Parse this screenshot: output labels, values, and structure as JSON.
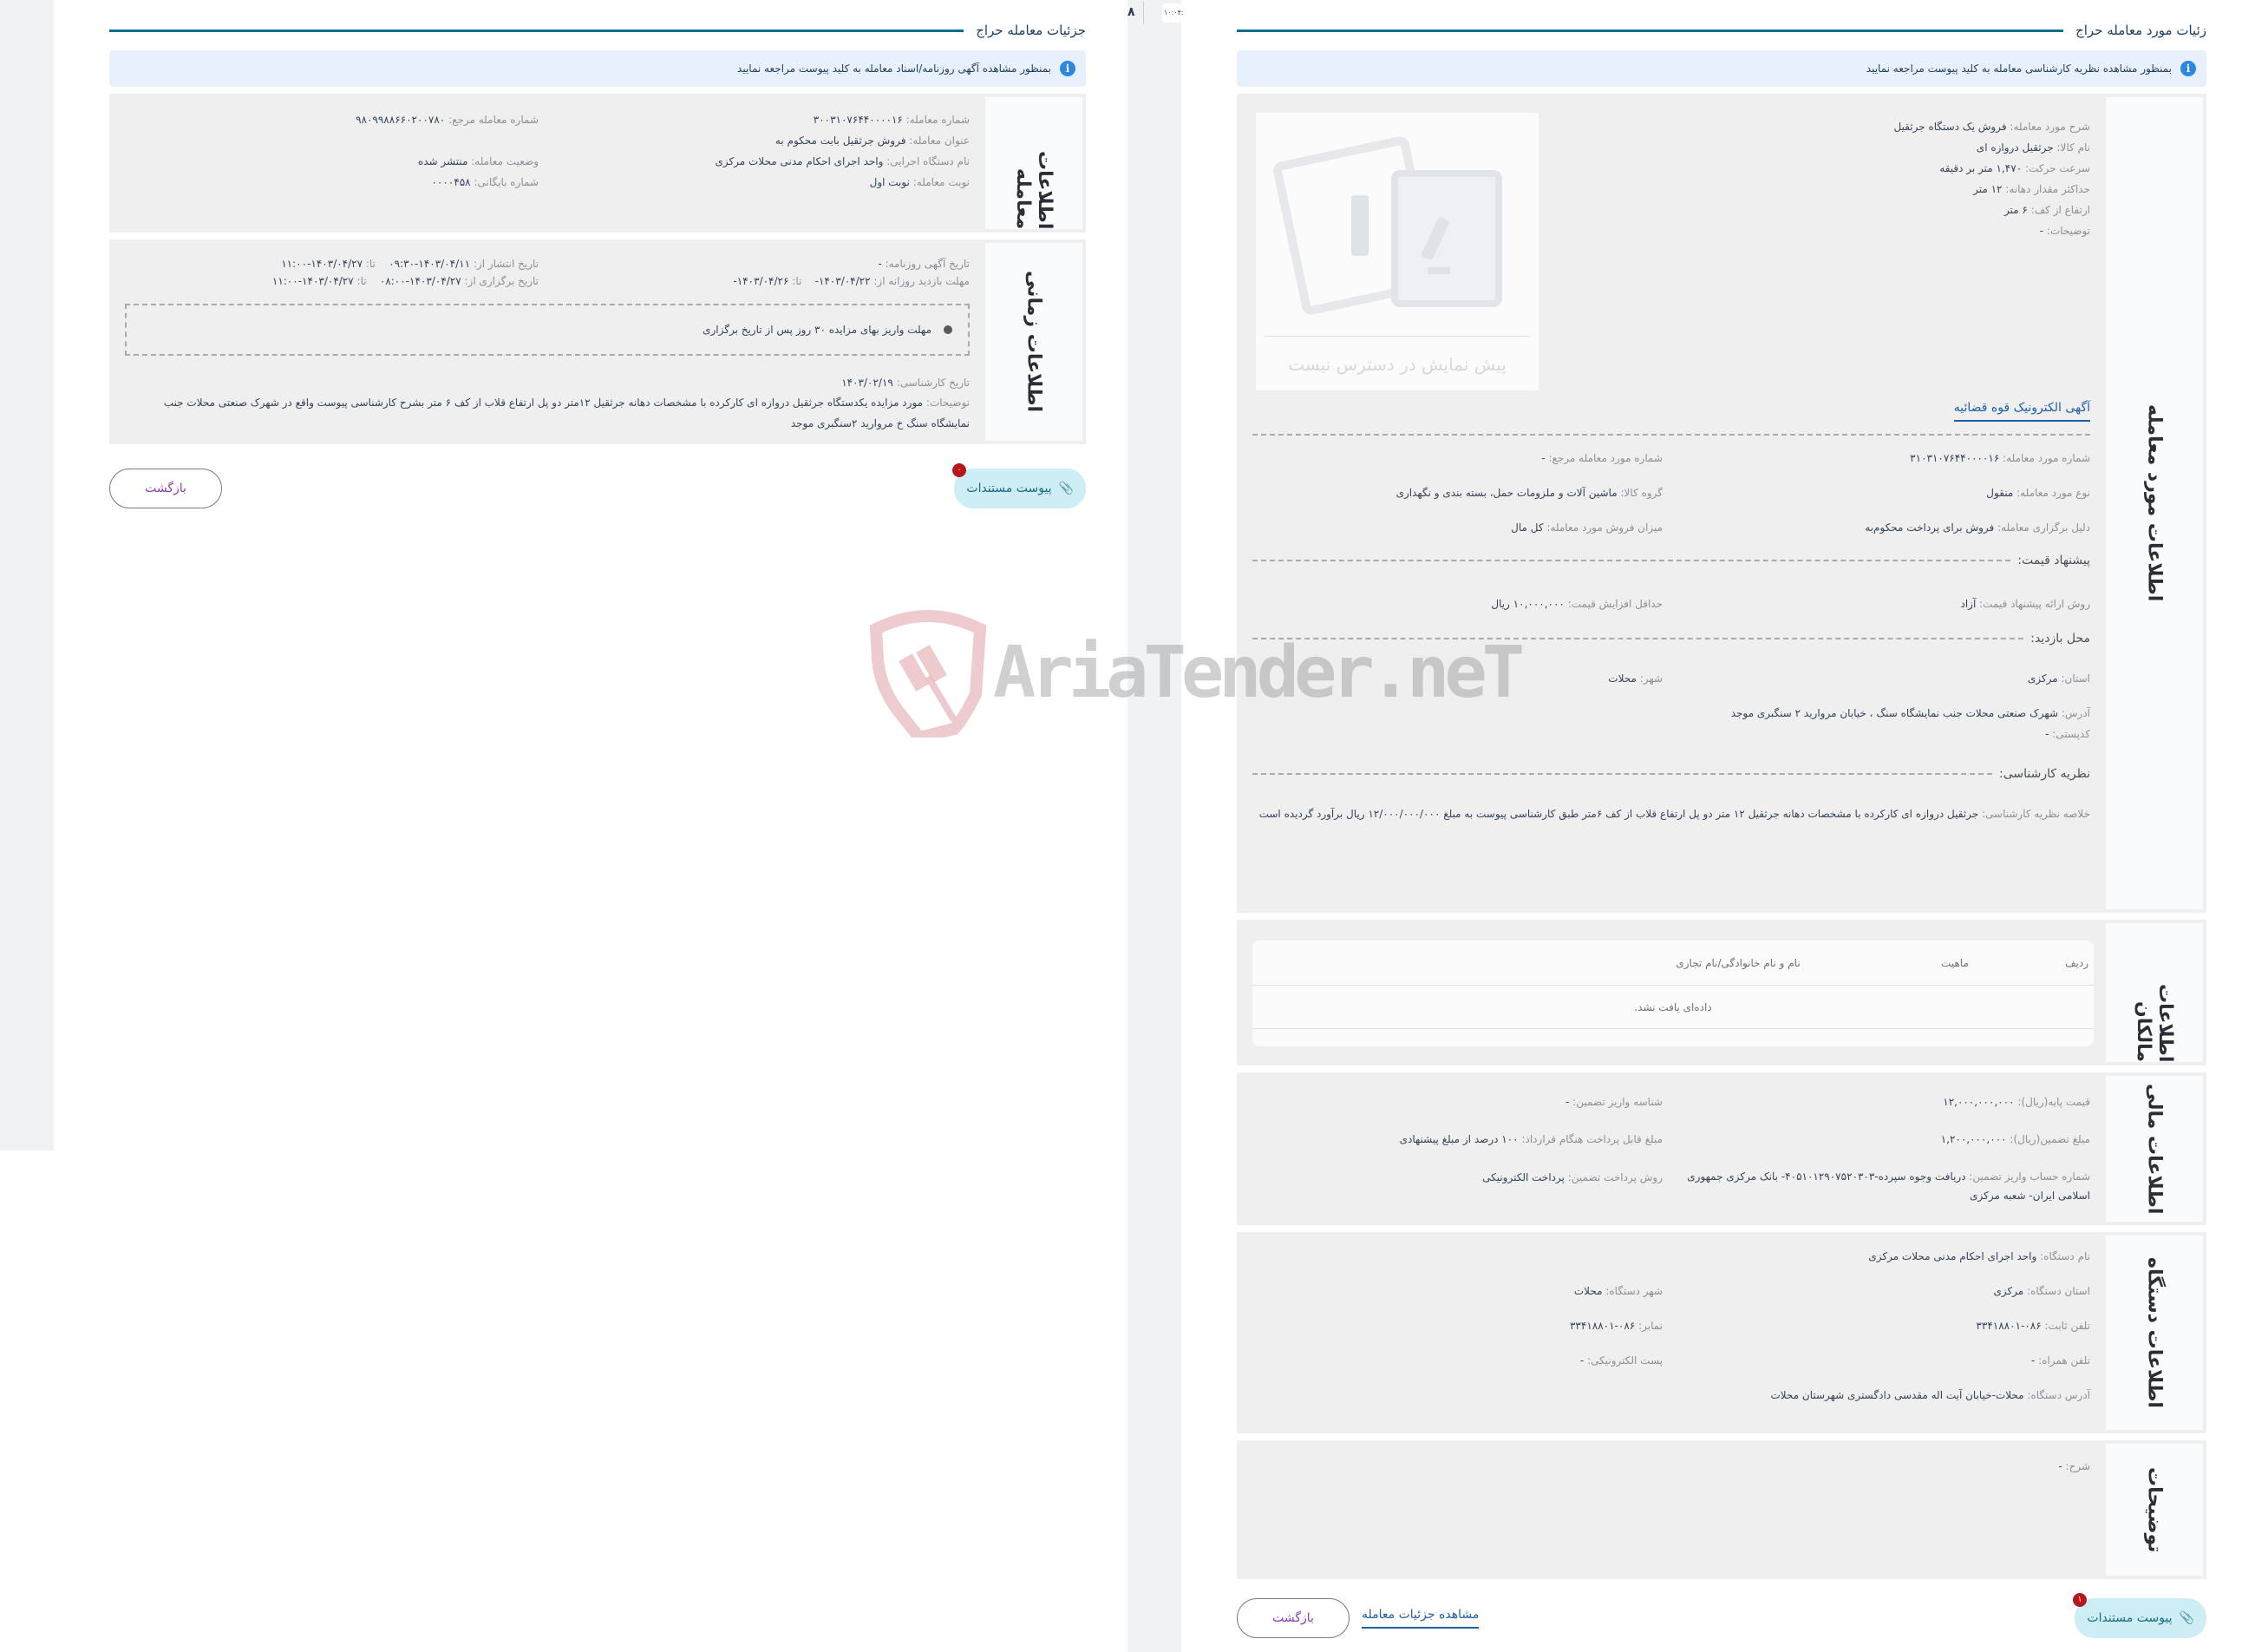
{
  "topbar": {
    "time_fragment": "۱۰:۰۴:",
    "glyph": "۸"
  },
  "left_panel": {
    "title": "جزئیات معامله حراج",
    "info_text": "بمنظور مشاهده آگهی روزنامه/اسناد معامله به کلید پیوست مراجعه نمایید",
    "deal_info": {
      "label": "اطلاعات معامله",
      "fields": {
        "deal_number": {
          "label": "شماره معامله:",
          "value": "۳۰۰۳۱۰۷۶۴۴۰۰۰۰۱۶"
        },
        "ref_number": {
          "label": "شماره معامله مرجع:",
          "value": "۹۸۰۹۹۸۸۶۶۰۲۰۰۷۸۰"
        },
        "deal_title": {
          "label": "عنوان معامله:",
          "value": "فروش جرثقیل بابت محکوم به"
        },
        "executor": {
          "label": "نام دستگاه اجرایی:",
          "value": "واحد اجرای احکام مدنی محلات مرکزی"
        },
        "status": {
          "label": "وضعیت معامله:",
          "value": "منتشر شده"
        },
        "round": {
          "label": "نوبت معامله:",
          "value": "نوبت اول"
        },
        "archive": {
          "label": "شماره بایگانی:",
          "value": "۰۰۰۰۴۵۸"
        }
      }
    },
    "time_info": {
      "label": "اطلاعات زمانی",
      "newspaper_date": {
        "label": "تاریخ آگهی روزنامه:",
        "value": "-"
      },
      "visit": {
        "label": "مهلت بازدید روزانه از:",
        "from": "۱۴۰۳/۰۴/۲۲-",
        "to_label": "تا:",
        "to": "۱۴۰۳/۰۴/۲۶-"
      },
      "publish": {
        "label": "تاریخ انتشار از:",
        "from": "۱۴۰۳/۰۴/۱۱-۰۹:۳۰",
        "to_label": "تا:",
        "to": "۱۴۰۳/۰۴/۲۷-۱۱:۰۰"
      },
      "hold": {
        "label": "تاریخ برگزاری از:",
        "from": "۱۴۰۳/۰۴/۲۷-۰۸:۰۰",
        "to_label": "تا:",
        "to": "۱۴۰۳/۰۴/۲۷-۱۱:۰۰"
      },
      "notice": "مهلت واریز بهای مزایده ۳۰ روز پس از تاریخ برگزاری",
      "expert_date": {
        "label": "تاریخ کارشناسی:",
        "value": "۱۴۰۳/۰۲/۱۹"
      },
      "description": {
        "label": "توضیحات:",
        "value": "مورد مزایده یکدستگاه جرثقیل دروازه ای کارکرده با مشخصات دهانه جرثقیل ۱۲متر دو پل ارتفاع قلاب از کف ۶ متر بشرح کارشناسی پیوست واقع در شهرک صنعتی محلات جنب نمایشگاه سنگ خ مروارید ۲سنگبری موجد"
      }
    },
    "attach_button": "پیوست مستندات",
    "attach_badge": "۰",
    "back_button": "بازگشت"
  },
  "right_panel": {
    "title": "زئیات مورد معامله حراج",
    "info_text": "بمنظور مشاهده نظریه کارشناسی معامله به کلید پیوست مراجعه نمایید",
    "item_info": {
      "label": "اطلاعات مورد معامله",
      "preview_text": "پیش نمایش در دسترس نیست",
      "specs": [
        {
          "label": "شرح مورد معامله:",
          "value": "فروش یک دستگاه جرثقیل"
        },
        {
          "label": "نام کالا:",
          "value": "جرثقیل دروازه ای"
        },
        {
          "label": "سرعت حرکت:",
          "value": "۱,۴۷۰ متر بر دقیقه"
        },
        {
          "label": "حداکثر مقدار دهانه:",
          "value": "۱۲ متر"
        },
        {
          "label": "ارتفاع از کف:",
          "value": "۶ متر"
        },
        {
          "label": "توضیحات:",
          "value": "-"
        }
      ],
      "ad_link": "آگهی الکترونیک قوه قضائیه",
      "item_number": {
        "label": "شماره مورد معامله:",
        "value": "۳۱۰۳۱۰۷۶۴۴۰۰۰۰۱۶"
      },
      "item_ref": {
        "label": "شماره مورد معامله مرجع:",
        "value": "-"
      },
      "item_type": {
        "label": "نوع مورد معامله:",
        "value": "منقول"
      },
      "goods_group": {
        "label": "گروه کالا:",
        "value": "ماشین آلات و ملزومات حمل، بسته بندی و نگهداری"
      },
      "reason": {
        "label": "دلیل برگزاری معامله:",
        "value": "فروش برای پرداخت محکوم‌به"
      },
      "sale_amount": {
        "label": "میزان فروش مورد معامله:",
        "value": "کل مال"
      },
      "price_head": "پیشنهاد قیمت:",
      "price_method": {
        "label": "روش ارائه پیشنهاد قیمت:",
        "value": "آزاد"
      },
      "min_increase": {
        "label": "حداقل افزایش قیمت:",
        "value": "۱۰,۰۰۰,۰۰۰ ریال"
      },
      "visit_head": "محل بازدید:",
      "province": {
        "label": "استان:",
        "value": "مرکزی"
      },
      "city": {
        "label": "شهر:",
        "value": "محلات"
      },
      "address": {
        "label": "آدرس:",
        "value": "شهرک صنعتی محلات جنب نمایشگاه سنگ ، خیابان مروارید ۲ سنگبری موجد"
      },
      "postal": {
        "label": "کدپستی:",
        "value": "-"
      },
      "expert_head": "نظریه کارشناسی:",
      "expert_summary": {
        "label": "خلاصه نظریه کارشناسی:",
        "value": "جرثقیل دروازه ای کارکرده با مشخصات دهانه جرثقیل ۱۲ متر دو پل ارتفاع قلاب از کف ۶متر طبق کارشناسی پیوست به مبلغ ۱۲/۰۰۰/۰۰۰/۰۰۰ ریال برآورد گردیده است"
      }
    },
    "owners": {
      "label": "اطلاعات مالکان",
      "columns": [
        "ردیف",
        "ماهیت",
        "نام و نام خانوادگی/نام تجاری"
      ],
      "empty_text": "داده‌ای یافت نشد."
    },
    "financial": {
      "label": "اطلاعات مالی",
      "base_price": {
        "label": "قیمت پایه(ریال):",
        "value": "۱۲,۰۰۰,۰۰۰,۰۰۰"
      },
      "guarantee_id": {
        "label": "شناسه واریز تضمین:",
        "value": "-"
      },
      "guarantee_amount": {
        "label": "مبلغ تضمین(ریال):",
        "value": "۱,۲۰۰,۰۰۰,۰۰۰"
      },
      "payable": {
        "label": "مبلغ قابل پرداخت هنگام قرارداد:",
        "value": "۱۰۰ درصد از مبلغ پیشنهادی"
      },
      "account": {
        "label": "شماره حساب واریز تضمین:",
        "value": "دریافت وجوه سپرده-۴۰۵۱۰۱۲۹۰۷۵۲۰۳۰۳- بانک مرکزی جمهوری اسلامی ایران- شعبه مرکزی"
      },
      "pay_method": {
        "label": "روش پرداخت تضمین:",
        "value": "پرداخت الکترونیکی"
      }
    },
    "agency": {
      "label": "اطلاعات دستگاه",
      "name": {
        "label": "نام دستگاه:",
        "value": "واحد اجرای احکام مدنی محلات مرکزی"
      },
      "province": {
        "label": "استان دستگاه:",
        "value": "مرکزی"
      },
      "city": {
        "label": "شهر دستگاه:",
        "value": "محلات"
      },
      "phone": {
        "label": "تلفن ثابت:",
        "value": "۰۸۶-۳۳۴۱۸۸۰۱"
      },
      "fax": {
        "label": "نمابر:",
        "value": "۰۸۶-۳۳۴۱۸۸۰۱"
      },
      "mobile": {
        "label": "تلفن همراه:",
        "value": "-"
      },
      "email": {
        "label": "پست الکترونیکی:",
        "value": "-"
      },
      "address": {
        "label": "آدرس دستگاه:",
        "value": "محلات-خیابان آیت اله مقدسی دادگستری شهرستان محلات"
      }
    },
    "notes": {
      "label": "توضیحات",
      "desc": {
        "label": "شرح:",
        "value": "-"
      }
    },
    "attach_button": "پیوست مستندات",
    "attach_badge": "۱",
    "details_link": "مشاهده جزئیات معامله",
    "back_button": "بازگشت"
  },
  "watermark": {
    "text": "AriaTender.neT"
  },
  "colors": {
    "accent_line": "#0d6f8c",
    "info_bg": "#e8f1fb",
    "attach_bg": "#cdeef5",
    "badge": "#b5171f",
    "back_text": "#8a3db0",
    "link": "#1f5fa6"
  }
}
